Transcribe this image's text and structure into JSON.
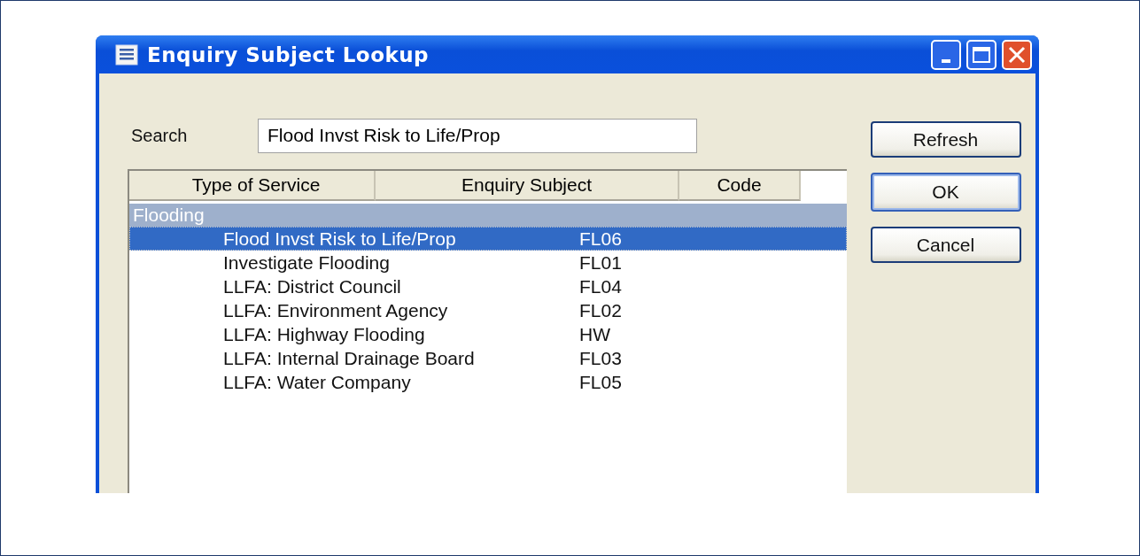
{
  "window": {
    "title": "Enquiry Subject Lookup"
  },
  "search": {
    "label": "Search",
    "value": "Flood Invst Risk to Life/Prop"
  },
  "list": {
    "columns": [
      "Type of Service",
      "Enquiry Subject",
      "Code"
    ],
    "groups": [
      {
        "label": "Flooding",
        "rows": [
          {
            "subject": "Flood Invst Risk to Life/Prop",
            "code": "FL06",
            "selected": true
          },
          {
            "subject": "Investigate Flooding",
            "code": "FL01",
            "selected": false
          },
          {
            "subject": "LLFA: District Council",
            "code": "FL04",
            "selected": false
          },
          {
            "subject": "LLFA: Environment Agency",
            "code": "FL02",
            "selected": false
          },
          {
            "subject": "LLFA: Highway Flooding",
            "code": "HW",
            "selected": false
          },
          {
            "subject": "LLFA: Internal Drainage Board",
            "code": "FL03",
            "selected": false
          },
          {
            "subject": "LLFA: Water Company",
            "code": "FL05",
            "selected": false
          }
        ]
      }
    ]
  },
  "buttons": [
    {
      "label": "Refresh",
      "default": false
    },
    {
      "label": "OK",
      "default": true
    },
    {
      "label": "Cancel",
      "default": false
    }
  ]
}
